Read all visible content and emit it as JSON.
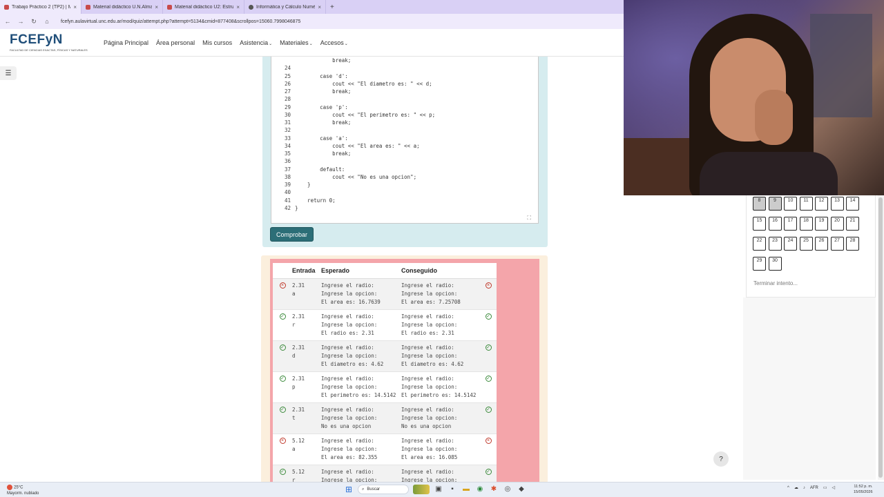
{
  "browser": {
    "tabs": [
      {
        "label": "Trabajo Práctico 2 (TP2) | MYA",
        "active": true
      },
      {
        "label": "Material didáctico U.N.Almacenam",
        "active": false
      },
      {
        "label": "Material didáctico U2: Estructuras",
        "active": false
      },
      {
        "label": "Informática y Cálculo Numérico",
        "active": false
      }
    ],
    "url": "fcefyn.aulavirtual.unc.edu.ar/mod/quiz/attempt.php?attempt=5134&cmid=877408&scrollpos=15060.7998046875"
  },
  "header": {
    "logo_text": "FCEFyN",
    "logo_tagline": "FACULTAD DE CIENCIAS EXACTAS, FÍSICAS Y NATURALES",
    "nav": [
      {
        "label": "Página Principal",
        "dropdown": false
      },
      {
        "label": "Área personal",
        "dropdown": false
      },
      {
        "label": "Mis cursos",
        "dropdown": false
      },
      {
        "label": "Asistencia",
        "dropdown": true
      },
      {
        "label": "Materiales",
        "dropdown": true
      },
      {
        "label": "Accesos",
        "dropdown": true
      }
    ]
  },
  "code": {
    "lines": [
      {
        "n": "",
        "text": "            break;"
      },
      {
        "n": "24",
        "text": ""
      },
      {
        "n": "25",
        "text": "        case 'd':"
      },
      {
        "n": "26",
        "text": "            cout << \"El diametro es: \" << d;"
      },
      {
        "n": "27",
        "text": "            break;"
      },
      {
        "n": "28",
        "text": ""
      },
      {
        "n": "29",
        "text": "        case 'p':"
      },
      {
        "n": "30",
        "text": "            cout << \"El perimetro es: \" << p;"
      },
      {
        "n": "31",
        "text": "            break;"
      },
      {
        "n": "32",
        "text": ""
      },
      {
        "n": "33",
        "text": "        case 'a':"
      },
      {
        "n": "34",
        "text": "            cout << \"El area es: \" << a;"
      },
      {
        "n": "35",
        "text": "            break;"
      },
      {
        "n": "36",
        "text": ""
      },
      {
        "n": "37",
        "text": "        default:"
      },
      {
        "n": "38",
        "text": "            cout << \"No es una opcion\";"
      },
      {
        "n": "39",
        "text": "    }"
      },
      {
        "n": "40",
        "text": ""
      },
      {
        "n": "41",
        "text": "    return 0;"
      },
      {
        "n": "42",
        "text": "}"
      }
    ],
    "check_button": "Comprobar"
  },
  "results": {
    "headers": {
      "entrada": "Entrada",
      "esperado": "Esperado",
      "conseguido": "Conseguido"
    },
    "rows": [
      {
        "status": "fail",
        "entrada": "2.31\na",
        "esperado": "Ingrese el radio:\nIngrese la opcion:\nEl area es: 16.7639",
        "conseguido": "Ingrese el radio:\nIngrese la opcion:\nEl area es: 7.25708"
      },
      {
        "status": "ok",
        "entrada": "2.31\nr",
        "esperado": "Ingrese el radio:\nIngrese la opcion:\nEl radio es: 2.31",
        "conseguido": "Ingrese el radio:\nIngrese la opcion:\nEl radio es: 2.31"
      },
      {
        "status": "ok",
        "entrada": "2.31\nd",
        "esperado": "Ingrese el radio:\nIngrese la opcion:\nEl diametro es: 4.62",
        "conseguido": "Ingrese el radio:\nIngrese la opcion:\nEl diametro es: 4.62"
      },
      {
        "status": "ok",
        "entrada": "2.31\np",
        "esperado": "Ingrese el radio:\nIngrese la opcion:\nEl perimetro es: 14.5142",
        "conseguido": "Ingrese el radio:\nIngrese la opcion:\nEl perimetro es: 14.5142"
      },
      {
        "status": "ok",
        "entrada": "2.31\nt",
        "esperado": "Ingrese el radio:\nIngrese la opcion:\nNo es una opcion",
        "conseguido": "Ingrese el radio:\nIngrese la opcion:\nNo es una opcion"
      },
      {
        "status": "fail",
        "entrada": "5.12\na",
        "esperado": "Ingrese el radio:\nIngrese la opcion:\nEl area es: 82.355",
        "conseguido": "Ingrese el radio:\nIngrese la opcion:\nEl area es: 16.085"
      },
      {
        "status": "ok",
        "entrada": "5.12\nr",
        "esperado": "Ingrese el radio:\nIngrese la opcion:",
        "conseguido": "Ingrese el radio:\nIngrese la opcion:"
      }
    ]
  },
  "quiz_nav": {
    "buttons": [
      {
        "label": "8",
        "done": true
      },
      {
        "label": "9",
        "done": true
      },
      {
        "label": "10",
        "done": false
      },
      {
        "label": "11",
        "done": false
      },
      {
        "label": "12",
        "done": false
      },
      {
        "label": "13",
        "done": false
      },
      {
        "label": "14",
        "done": false
      },
      {
        "label": "15",
        "done": false
      },
      {
        "label": "16",
        "done": false
      },
      {
        "label": "17",
        "done": false
      },
      {
        "label": "18",
        "done": false
      },
      {
        "label": "19",
        "done": false
      },
      {
        "label": "20",
        "done": false
      },
      {
        "label": "21",
        "done": false
      },
      {
        "label": "22",
        "done": false
      },
      {
        "label": "23",
        "done": false
      },
      {
        "label": "24",
        "done": false
      },
      {
        "label": "25",
        "done": false
      },
      {
        "label": "26",
        "done": false
      },
      {
        "label": "27",
        "done": false
      },
      {
        "label": "28",
        "done": false
      },
      {
        "label": "29",
        "done": false
      },
      {
        "label": "30",
        "done": false
      }
    ],
    "finish_label": "Terminar intento..."
  },
  "help_label": "?",
  "taskbar": {
    "weather_temp": "25°C",
    "weather_desc": "Mayorm. nublado",
    "search_placeholder": "Buscar",
    "lang": "AFR",
    "time": "11:52 p. m.",
    "date": "15/05/2026"
  }
}
